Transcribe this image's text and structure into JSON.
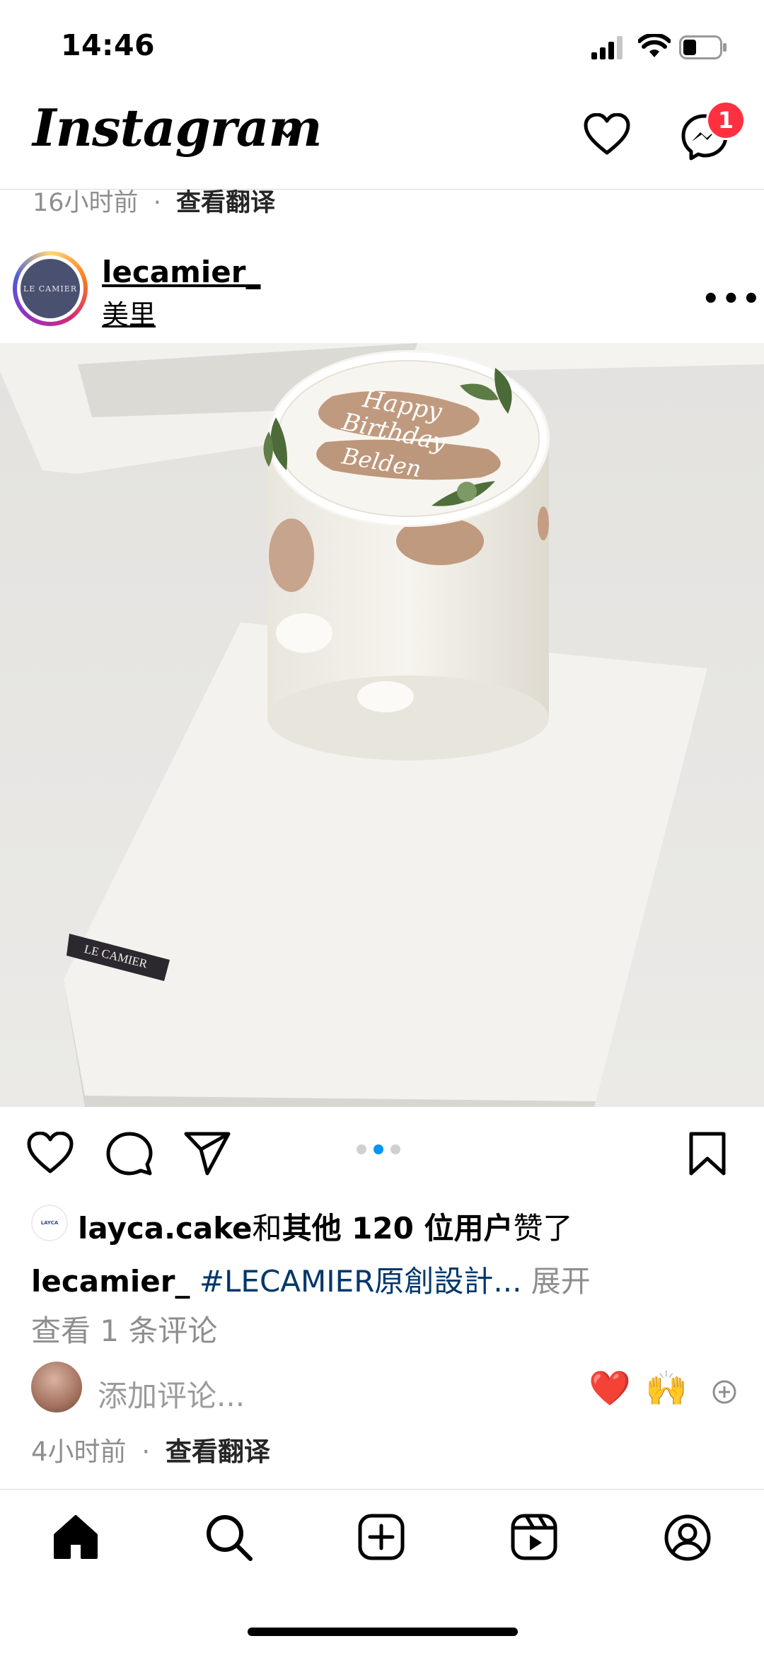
{
  "status_bar": {
    "time": "14:46"
  },
  "header": {
    "app_title": "Instagram",
    "notification_badge": "1"
  },
  "previous_post": {
    "time": "16小时前",
    "separator": "·",
    "translate": "查看翻译"
  },
  "post": {
    "username": "lecamier_",
    "location": "美里",
    "photo": {
      "cake_writing": [
        "Happy",
        "Birthday",
        "Belden"
      ],
      "board_label": "LE CAMIER",
      "avatar_label": "LE CAMIER"
    },
    "carousel": {
      "count": 3,
      "active_index": 1
    },
    "likes": {
      "user": "layca.cake",
      "connector": "和",
      "others": "其他 120 位用户",
      "suffix": "赞了",
      "avatar_label": "LAYCA"
    },
    "caption": {
      "username": "lecamier_",
      "text": "#LECAMIER原創設計...",
      "more": "展开"
    },
    "view_comments": "查看 1 条评论",
    "add_comment_placeholder": "添加评论...",
    "quick_reactions": [
      "❤️",
      "🙌"
    ],
    "time": "4小时前",
    "separator": "·",
    "translate": "查看翻译"
  },
  "colors": {
    "link_blue": "#00376b",
    "accent_blue": "#0095f6",
    "badge_red": "#ff3040",
    "secondary_text": "#8e8e8e"
  },
  "icons": [
    "heart-icon",
    "messenger-icon",
    "like-icon",
    "comment-icon",
    "share-icon",
    "save-icon",
    "home-icon",
    "search-icon",
    "create-icon",
    "reels-icon",
    "profile-icon"
  ]
}
